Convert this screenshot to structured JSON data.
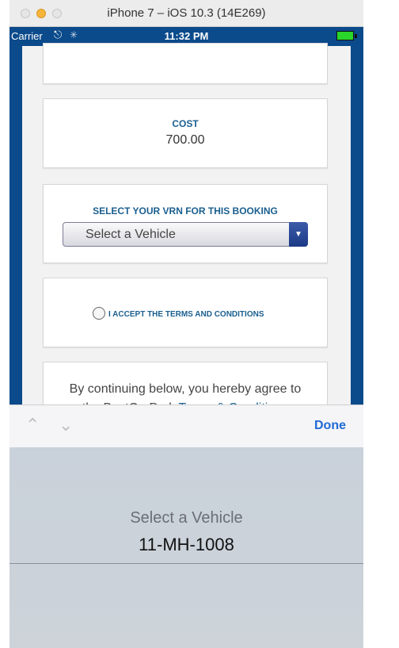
{
  "window": {
    "title": "iPhone 7 – iOS 10.3 (14E269)"
  },
  "status": {
    "carrier": "Carrier",
    "time": "11:32 PM"
  },
  "cost": {
    "label": "COST",
    "value": "700.00"
  },
  "vrn": {
    "label": "SELECT YOUR VRN FOR THIS BOOKING",
    "selected": "Select a Vehicle"
  },
  "terms": {
    "accept_label": "I ACCEPT THE TERMS AND CONDITIONS"
  },
  "agreement": {
    "text": "By continuing below, you hereby agree to the BestCarPark",
    "link": "Terms & Conditions"
  },
  "picker_toolbar": {
    "done_label": "Done"
  },
  "picker": {
    "options": [
      "Select a Vehicle",
      "11-MH-1008"
    ]
  },
  "colors": {
    "accent": "#1a5f8f",
    "background_blue": "#0b4a8b",
    "done": "#1f6ad6"
  }
}
